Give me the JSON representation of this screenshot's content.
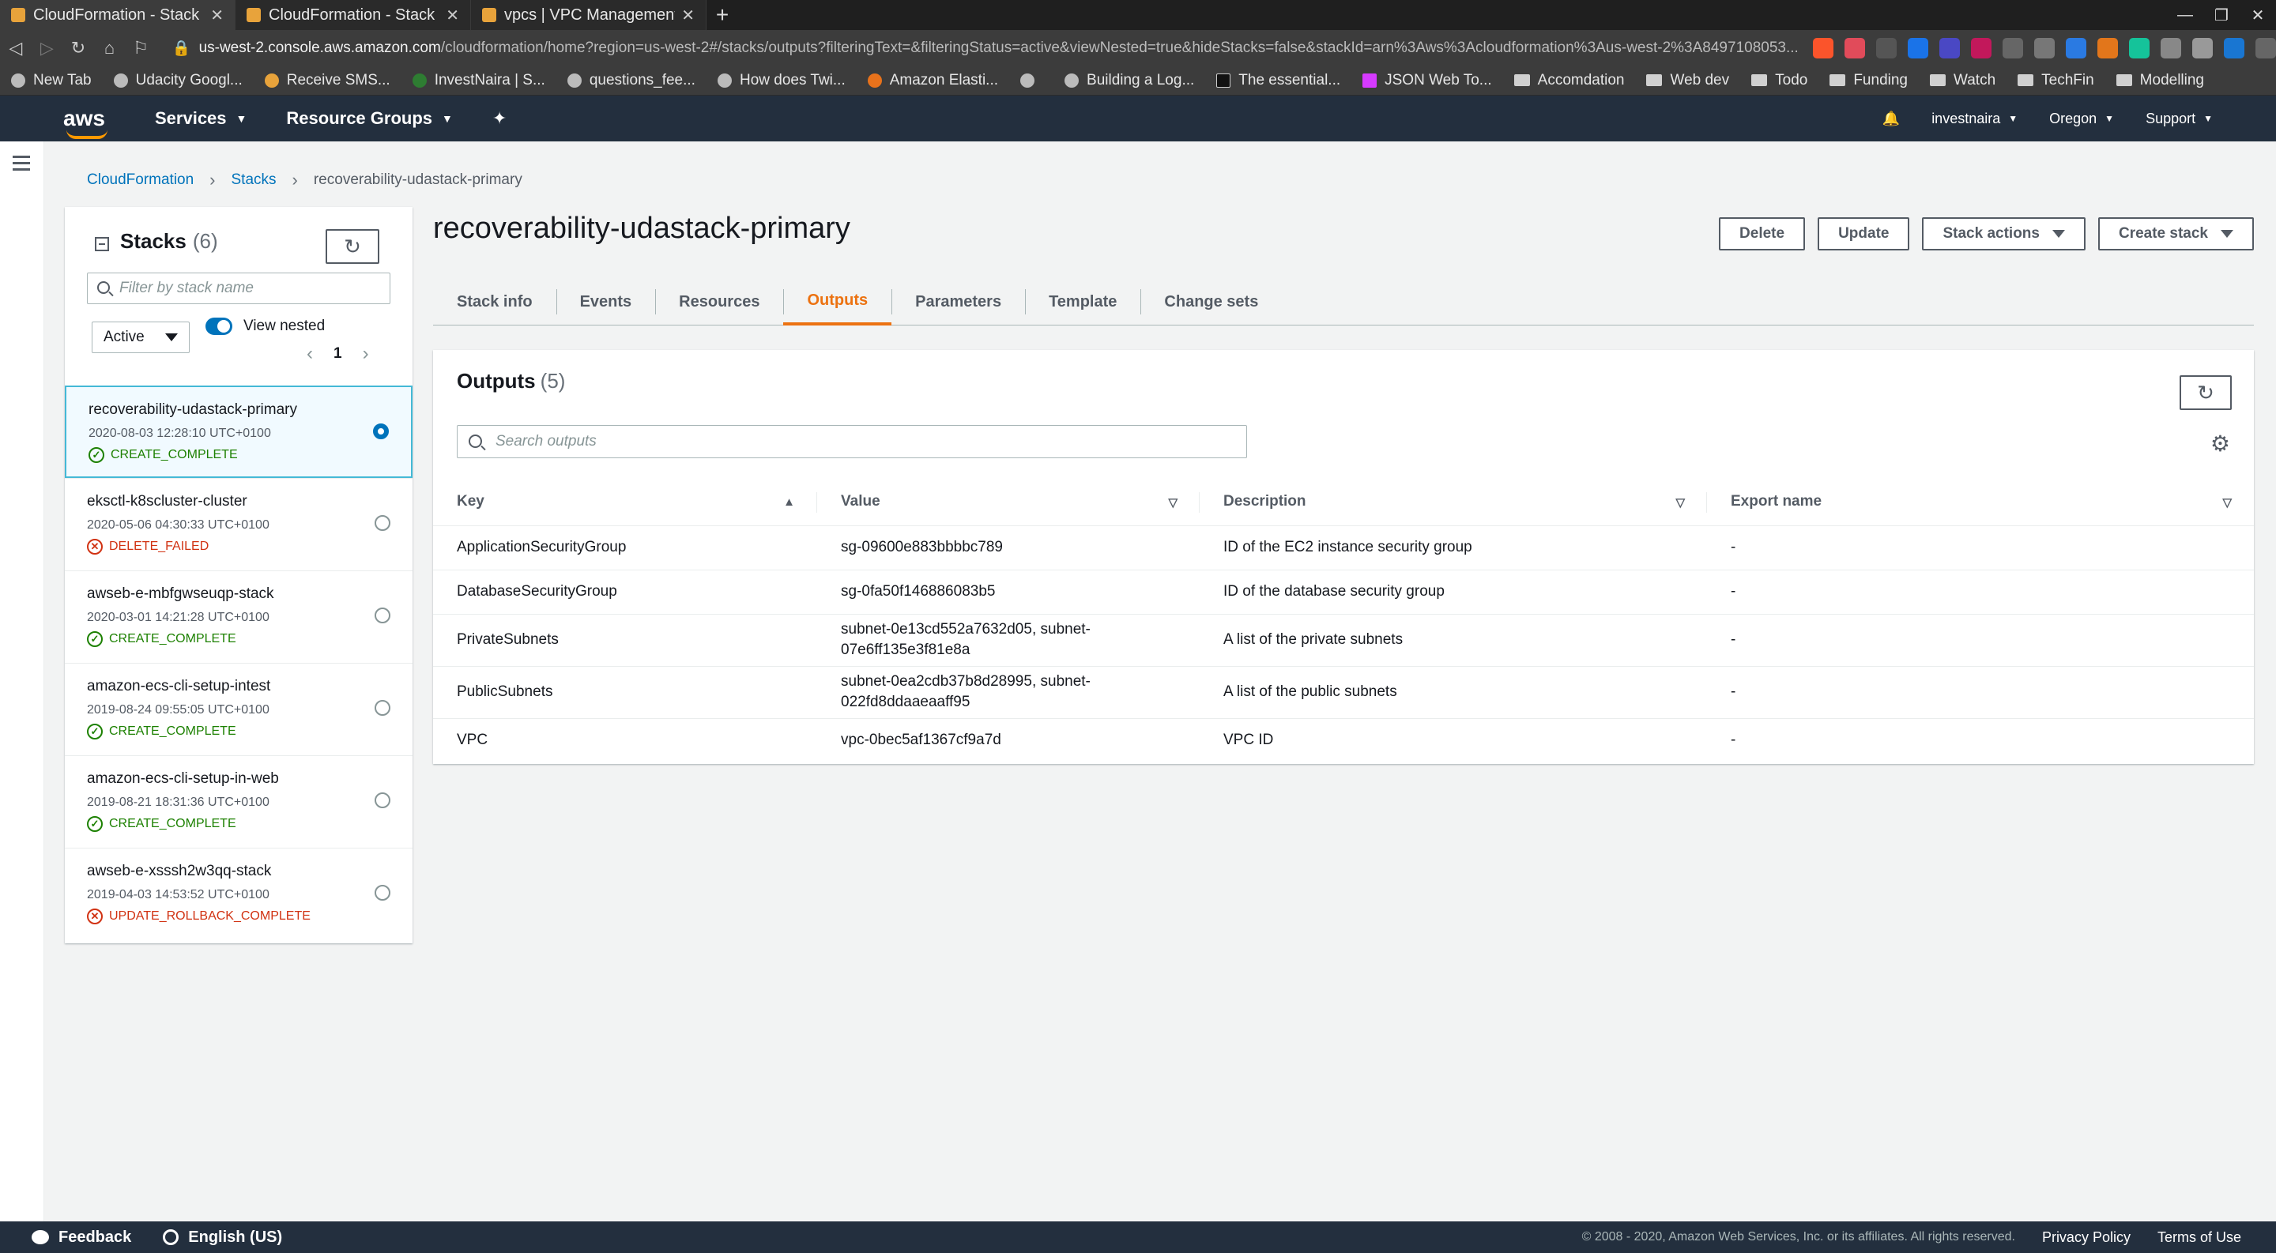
{
  "browser": {
    "tabs": [
      {
        "label": "CloudFormation - Stack rec",
        "active": true
      },
      {
        "label": "CloudFormation - Stack rec",
        "active": false
      },
      {
        "label": "vpcs | VPC Management Co",
        "active": false
      }
    ],
    "url_host": "us-west-2.console.aws.amazon.com",
    "url_path": "/cloudformation/home?region=us-west-2#/stacks/outputs?filteringText=&filteringStatus=active&viewNested=true&hideStacks=false&stackId=arn%3Aws%3Acloudformation%3Aus-west-2%3A8497108053...",
    "bookmarks": [
      {
        "label": "New Tab",
        "type": "page"
      },
      {
        "label": "Udacity Googl...",
        "type": "page"
      },
      {
        "label": "Receive SMS...",
        "type": "page"
      },
      {
        "label": "InvestNaira | S...",
        "type": "page"
      },
      {
        "label": "questions_fee...",
        "type": "page"
      },
      {
        "label": "How does Twi...",
        "type": "page"
      },
      {
        "label": "Amazon Elasti...",
        "type": "page"
      },
      {
        "label": "",
        "type": "page"
      },
      {
        "label": "Building a Log...",
        "type": "page"
      },
      {
        "label": "The essential...",
        "type": "page"
      },
      {
        "label": "JSON Web To...",
        "type": "page"
      },
      {
        "label": "Accomdation",
        "type": "folder"
      },
      {
        "label": "Web dev",
        "type": "folder"
      },
      {
        "label": "Todo",
        "type": "folder"
      },
      {
        "label": "Funding",
        "type": "folder"
      },
      {
        "label": "Watch",
        "type": "folder"
      },
      {
        "label": "TechFin",
        "type": "folder"
      },
      {
        "label": "Modelling",
        "type": "folder"
      }
    ]
  },
  "awsnav": {
    "logo": "aws",
    "services": "Services",
    "resource_groups": "Resource Groups",
    "account": "investnaira",
    "region": "Oregon",
    "support": "Support"
  },
  "breadcrumb": {
    "root": "CloudFormation",
    "stacks": "Stacks",
    "current": "recoverability-udastack-primary"
  },
  "stacks_panel": {
    "title": "Stacks",
    "count": "(6)",
    "filter_placeholder": "Filter by stack name",
    "status_filter": "Active",
    "view_nested_label": "View nested",
    "page": "1",
    "items": [
      {
        "name": "recoverability-udastack-primary",
        "date": "2020-08-03 12:28:10 UTC+0100",
        "status": "CREATE_COMPLETE"
      },
      {
        "name": "eksctl-k8scluster-cluster",
        "date": "2020-05-06 04:30:33 UTC+0100",
        "status": "DELETE_FAILED"
      },
      {
        "name": "awseb-e-mbfgwseuqp-stack",
        "date": "2020-03-01 14:21:28 UTC+0100",
        "status": "CREATE_COMPLETE"
      },
      {
        "name": "amazon-ecs-cli-setup-intest",
        "date": "2019-08-24 09:55:05 UTC+0100",
        "status": "CREATE_COMPLETE"
      },
      {
        "name": "amazon-ecs-cli-setup-in-web",
        "date": "2019-08-21 18:31:36 UTC+0100",
        "status": "CREATE_COMPLETE"
      },
      {
        "name": "awseb-e-xsssh2w3qq-stack",
        "date": "2019-04-03 14:53:52 UTC+0100",
        "status": "UPDATE_ROLLBACK_COMPLETE"
      }
    ]
  },
  "main": {
    "title": "recoverability-udastack-primary",
    "buttons": {
      "delete": "Delete",
      "update": "Update",
      "stack_actions": "Stack actions",
      "create_stack": "Create stack"
    },
    "tabs": [
      "Stack info",
      "Events",
      "Resources",
      "Outputs",
      "Parameters",
      "Template",
      "Change sets"
    ],
    "active_tab": "Outputs"
  },
  "outputs": {
    "title": "Outputs",
    "count": "(5)",
    "search_placeholder": "Search outputs",
    "columns": [
      "Key",
      "Value",
      "Description",
      "Export name"
    ],
    "rows": [
      {
        "key": "ApplicationSecurityGroup",
        "value_1": "sg-09600e883bbbbc789",
        "value_2": "",
        "description": "ID of the EC2 instance security group",
        "export": "-"
      },
      {
        "key": "DatabaseSecurityGroup",
        "value_1": "sg-0fa50f146886083b5",
        "value_2": "",
        "description": "ID of the database security group",
        "export": "-"
      },
      {
        "key": "PrivateSubnets",
        "value_1": "subnet-0e13cd552a7632d05, subnet-",
        "value_2": "07e6ff135e3f81e8a",
        "description": "A list of the private subnets",
        "export": "-"
      },
      {
        "key": "PublicSubnets",
        "value_1": "subnet-0ea2cdb37b8d28995, subnet-",
        "value_2": "022fd8ddaaeaaff95",
        "description": "A list of the public subnets",
        "export": "-"
      },
      {
        "key": "VPC",
        "value_1": "vpc-0bec5af1367cf9a7d",
        "value_2": "",
        "description": "VPC ID",
        "export": "-"
      }
    ]
  },
  "footer": {
    "feedback": "Feedback",
    "language": "English (US)",
    "copyright": "© 2008 - 2020, Amazon Web Services, Inc. or its affiliates. All rights reserved.",
    "privacy": "Privacy Policy",
    "terms": "Terms of Use"
  },
  "colors": {
    "aws_nav": "#232f3e",
    "accent_orange": "#ec7211",
    "link_blue": "#0073bb",
    "success_green": "#1d8102",
    "error_red": "#d13212"
  }
}
